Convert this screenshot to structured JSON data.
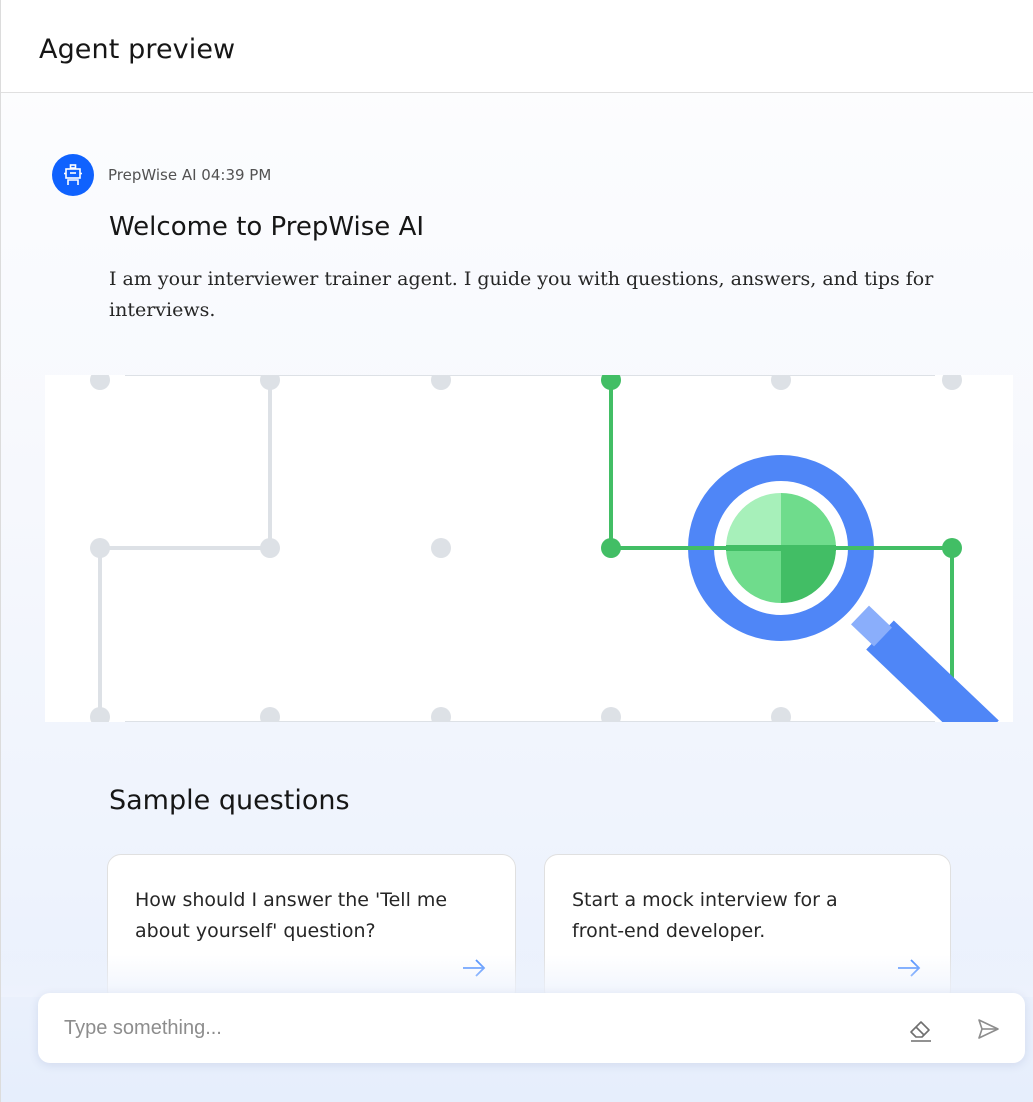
{
  "header": {
    "title": "Agent preview"
  },
  "message": {
    "sender": "PrepWise AI",
    "time": "04:39 PM",
    "meta": "PrepWise AI 04:39 PM",
    "avatar_icon": "robot-icon",
    "title": "Welcome to PrepWise AI",
    "body": "I am your interviewer trainer agent. I guide you with questions, answers, and tips for interviews."
  },
  "illustration": {
    "icon": "magnifying-glass-icon",
    "colors": {
      "accent_blue": "#4f86f7",
      "accent_green": "#42be65",
      "grid_gray": "#dde1e6"
    }
  },
  "samples": {
    "title": "Sample questions",
    "cards": [
      {
        "text": "How should I answer the 'Tell me about yourself' question?",
        "icon": "arrow-right-icon"
      },
      {
        "text": "Start a mock interview for a front-end developer.",
        "icon": "arrow-right-icon"
      }
    ]
  },
  "input": {
    "placeholder": "Type something...",
    "value": "",
    "clear_icon": "eraser-icon",
    "send_icon": "send-icon"
  },
  "colors": {
    "brand": "#0f62fe",
    "link_arrow": "#4589ff"
  }
}
